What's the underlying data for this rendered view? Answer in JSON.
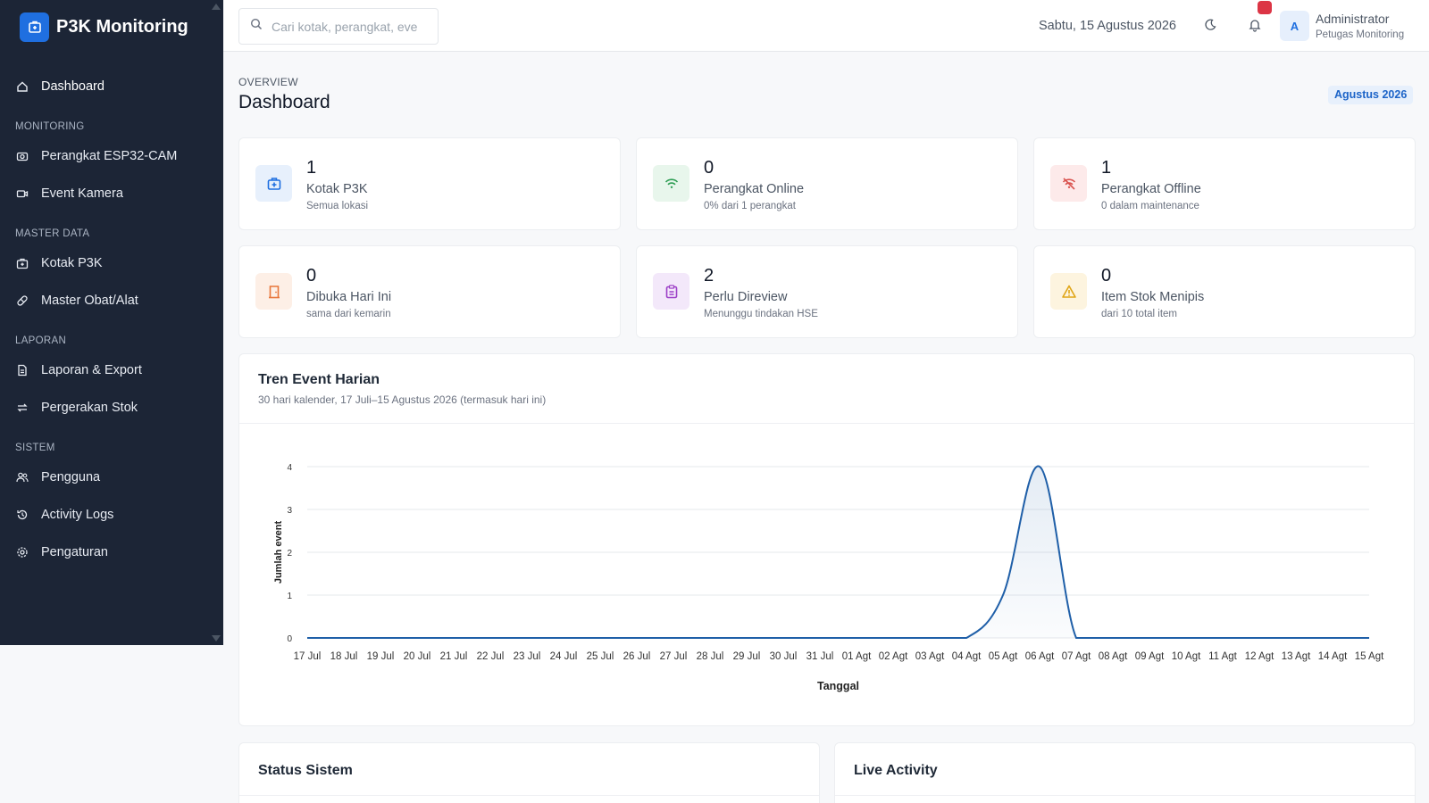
{
  "app": {
    "title": "P3K Monitoring"
  },
  "sidebar": {
    "dashboard": "Dashboard",
    "sections": [
      {
        "label": "MONITORING",
        "items": [
          "Perangkat ESP32-CAM",
          "Event Kamera"
        ]
      },
      {
        "label": "MASTER DATA",
        "items": [
          "Kotak P3K",
          "Master Obat/Alat"
        ]
      },
      {
        "label": "LAPORAN",
        "items": [
          "Laporan & Export",
          "Pergerakan Stok"
        ]
      },
      {
        "label": "SISTEM",
        "items": [
          "Pengguna",
          "Activity Logs",
          "Pengaturan"
        ]
      }
    ]
  },
  "topbar": {
    "search_placeholder": "Cari kotak, perangkat, eve",
    "date": "Sabtu, 15 Agustus 2026",
    "user_initial": "A",
    "user_name": "Administrator",
    "user_role": "Petugas Monitoring"
  },
  "header": {
    "eyebrow": "OVERVIEW",
    "title": "Dashboard",
    "period": "Agustus 2026"
  },
  "stats": [
    {
      "value": "1",
      "label": "Kotak P3K",
      "sub": "Semua lokasi",
      "icon": "first-aid-box-icon",
      "bg": "#e7f0fc",
      "color": "#1f6fe0"
    },
    {
      "value": "0",
      "label": "Perangkat Online",
      "sub": "0% dari 1 perangkat",
      "icon": "wifi-icon",
      "bg": "#e8f6ec",
      "color": "#2f9e55"
    },
    {
      "value": "1",
      "label": "Perangkat Offline",
      "sub": "0 dalam maintenance",
      "icon": "wifi-off-icon",
      "bg": "#fdeaea",
      "color": "#d9534f"
    },
    {
      "value": "0",
      "label": "Dibuka Hari Ini",
      "sub": "sama dari kemarin",
      "icon": "door-open-icon",
      "bg": "#fdefe6",
      "color": "#e8763a"
    },
    {
      "value": "2",
      "label": "Perlu Direview",
      "sub": "Menunggu tindakan HSE",
      "icon": "clipboard-icon",
      "bg": "#f3e8fa",
      "color": "#9c3fc7"
    },
    {
      "value": "0",
      "label": "Item Stok Menipis",
      "sub": "dari 10 total item",
      "icon": "warning-icon",
      "bg": "#fdf4df",
      "color": "#e0a516"
    }
  ],
  "chart": {
    "title": "Tren Event Harian",
    "subtitle": "30 hari kalender, 17 Juli–15 Agustus 2026 (termasuk hari ini)"
  },
  "chart_data": {
    "type": "area",
    "xlabel": "Tanggal",
    "ylabel": "Jumlah event",
    "ylim": [
      0,
      4
    ],
    "yticks": [
      0,
      1,
      2,
      3,
      4
    ],
    "grid": true,
    "line_color": "#1f5fa8",
    "categories": [
      "17 Jul",
      "18 Jul",
      "19 Jul",
      "20 Jul",
      "21 Jul",
      "22 Jul",
      "23 Jul",
      "24 Jul",
      "25 Jul",
      "26 Jul",
      "27 Jul",
      "28 Jul",
      "29 Jul",
      "30 Jul",
      "31 Jul",
      "01 Agt",
      "02 Agt",
      "03 Agt",
      "04 Agt",
      "05 Agt",
      "06 Agt",
      "07 Agt",
      "08 Agt",
      "09 Agt",
      "10 Agt",
      "11 Agt",
      "12 Agt",
      "13 Agt",
      "14 Agt",
      "15 Agt"
    ],
    "values": [
      0,
      0,
      0,
      0,
      0,
      0,
      0,
      0,
      0,
      0,
      0,
      0,
      0,
      0,
      0,
      0,
      0,
      0,
      0,
      1,
      4,
      0,
      0,
      0,
      0,
      0,
      0,
      0,
      0,
      0
    ]
  },
  "bottom": {
    "status_title": "Status Sistem",
    "live_title": "Live Activity"
  }
}
